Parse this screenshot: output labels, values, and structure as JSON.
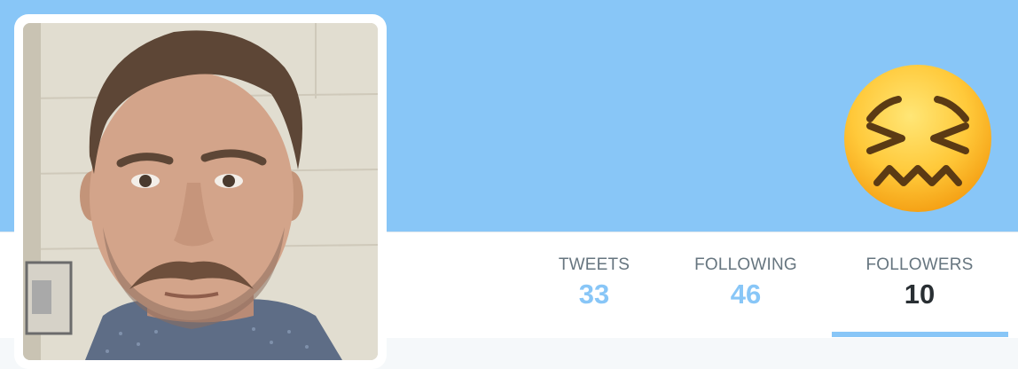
{
  "profile": {
    "avatar_alt": "profile photo",
    "status_emoji": "confounded-face"
  },
  "stats": {
    "tweets": {
      "label": "TWEETS",
      "value": "33"
    },
    "following": {
      "label": "FOLLOWING",
      "value": "46"
    },
    "followers": {
      "label": "FOLLOWERS",
      "value": "10"
    },
    "active_tab": "followers"
  },
  "colors": {
    "banner": "#88c6f7",
    "accent": "#88c6f7",
    "label": "#66757f",
    "active_value": "#292f33"
  }
}
